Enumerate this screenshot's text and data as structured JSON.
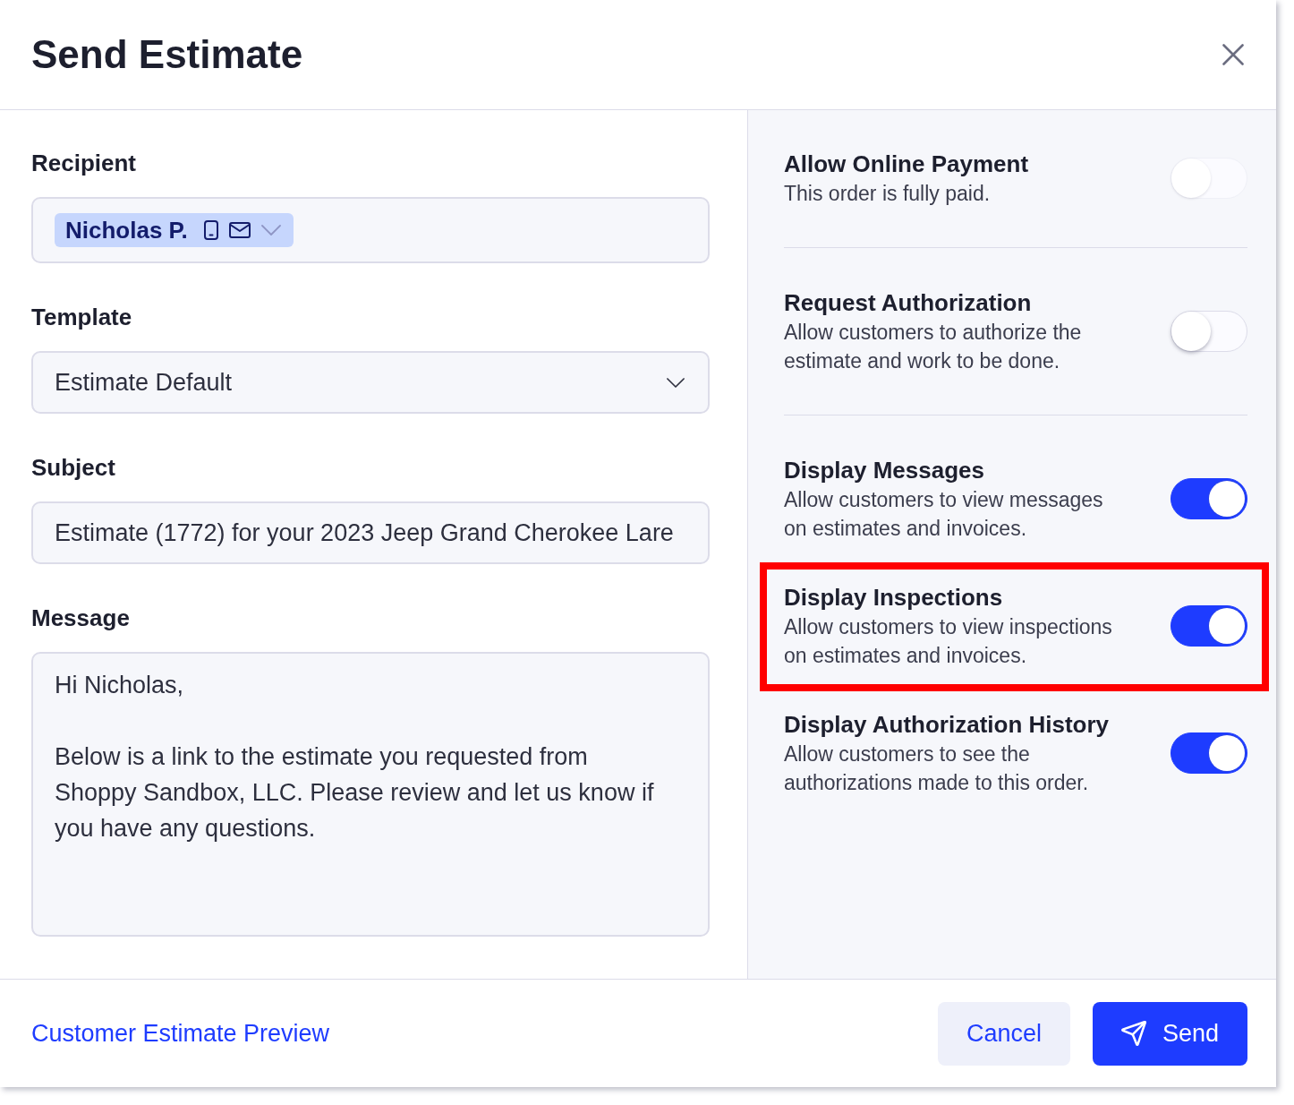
{
  "header": {
    "title": "Send Estimate"
  },
  "fields": [
    {
      "kind": "recipients",
      "label": "Recipient",
      "chips": [
        {
          "text": "Nicholas P."
        }
      ]
    },
    {
      "kind": "select",
      "label": "Template",
      "value": "Estimate Default"
    },
    {
      "kind": "text",
      "label": "Subject",
      "value": "Estimate (1772) for your 2023 Jeep Grand Cherokee Lare"
    },
    {
      "kind": "textarea",
      "label": "Message",
      "value": "Hi Nicholas,\n\nBelow is a link to the estimate you requested from Shoppy Sandbox, LLC. Please review and let us know if you have any questions."
    }
  ],
  "settings_groups": [
    {
      "options": [
        {
          "title": "Allow Online Payment",
          "description": "This order is fully paid.",
          "on": false,
          "disabled": true,
          "highlighted": false
        }
      ]
    },
    {
      "options": [
        {
          "title": "Request Authorization",
          "description": "Allow customers to authorize the estimate and work to be done.",
          "on": false,
          "disabled": false,
          "highlighted": false
        }
      ]
    },
    {
      "options": [
        {
          "title": "Display Messages",
          "description": "Allow customers to view messages on estimates and invoices.",
          "on": true,
          "disabled": false,
          "highlighted": false
        },
        {
          "title": "Display Inspections",
          "description": "Allow customers to view inspections on estimates and invoices.",
          "on": true,
          "disabled": false,
          "highlighted": true
        },
        {
          "title": "Display Authorization History",
          "description": "Allow customers to see the authorizations made to this order.",
          "on": true,
          "disabled": false,
          "highlighted": false
        }
      ]
    }
  ],
  "footer": {
    "preview_link": "Customer Estimate Preview",
    "buttons": [
      {
        "kind": "secondary",
        "label": "Cancel"
      },
      {
        "kind": "primary",
        "label": "Send"
      }
    ]
  }
}
